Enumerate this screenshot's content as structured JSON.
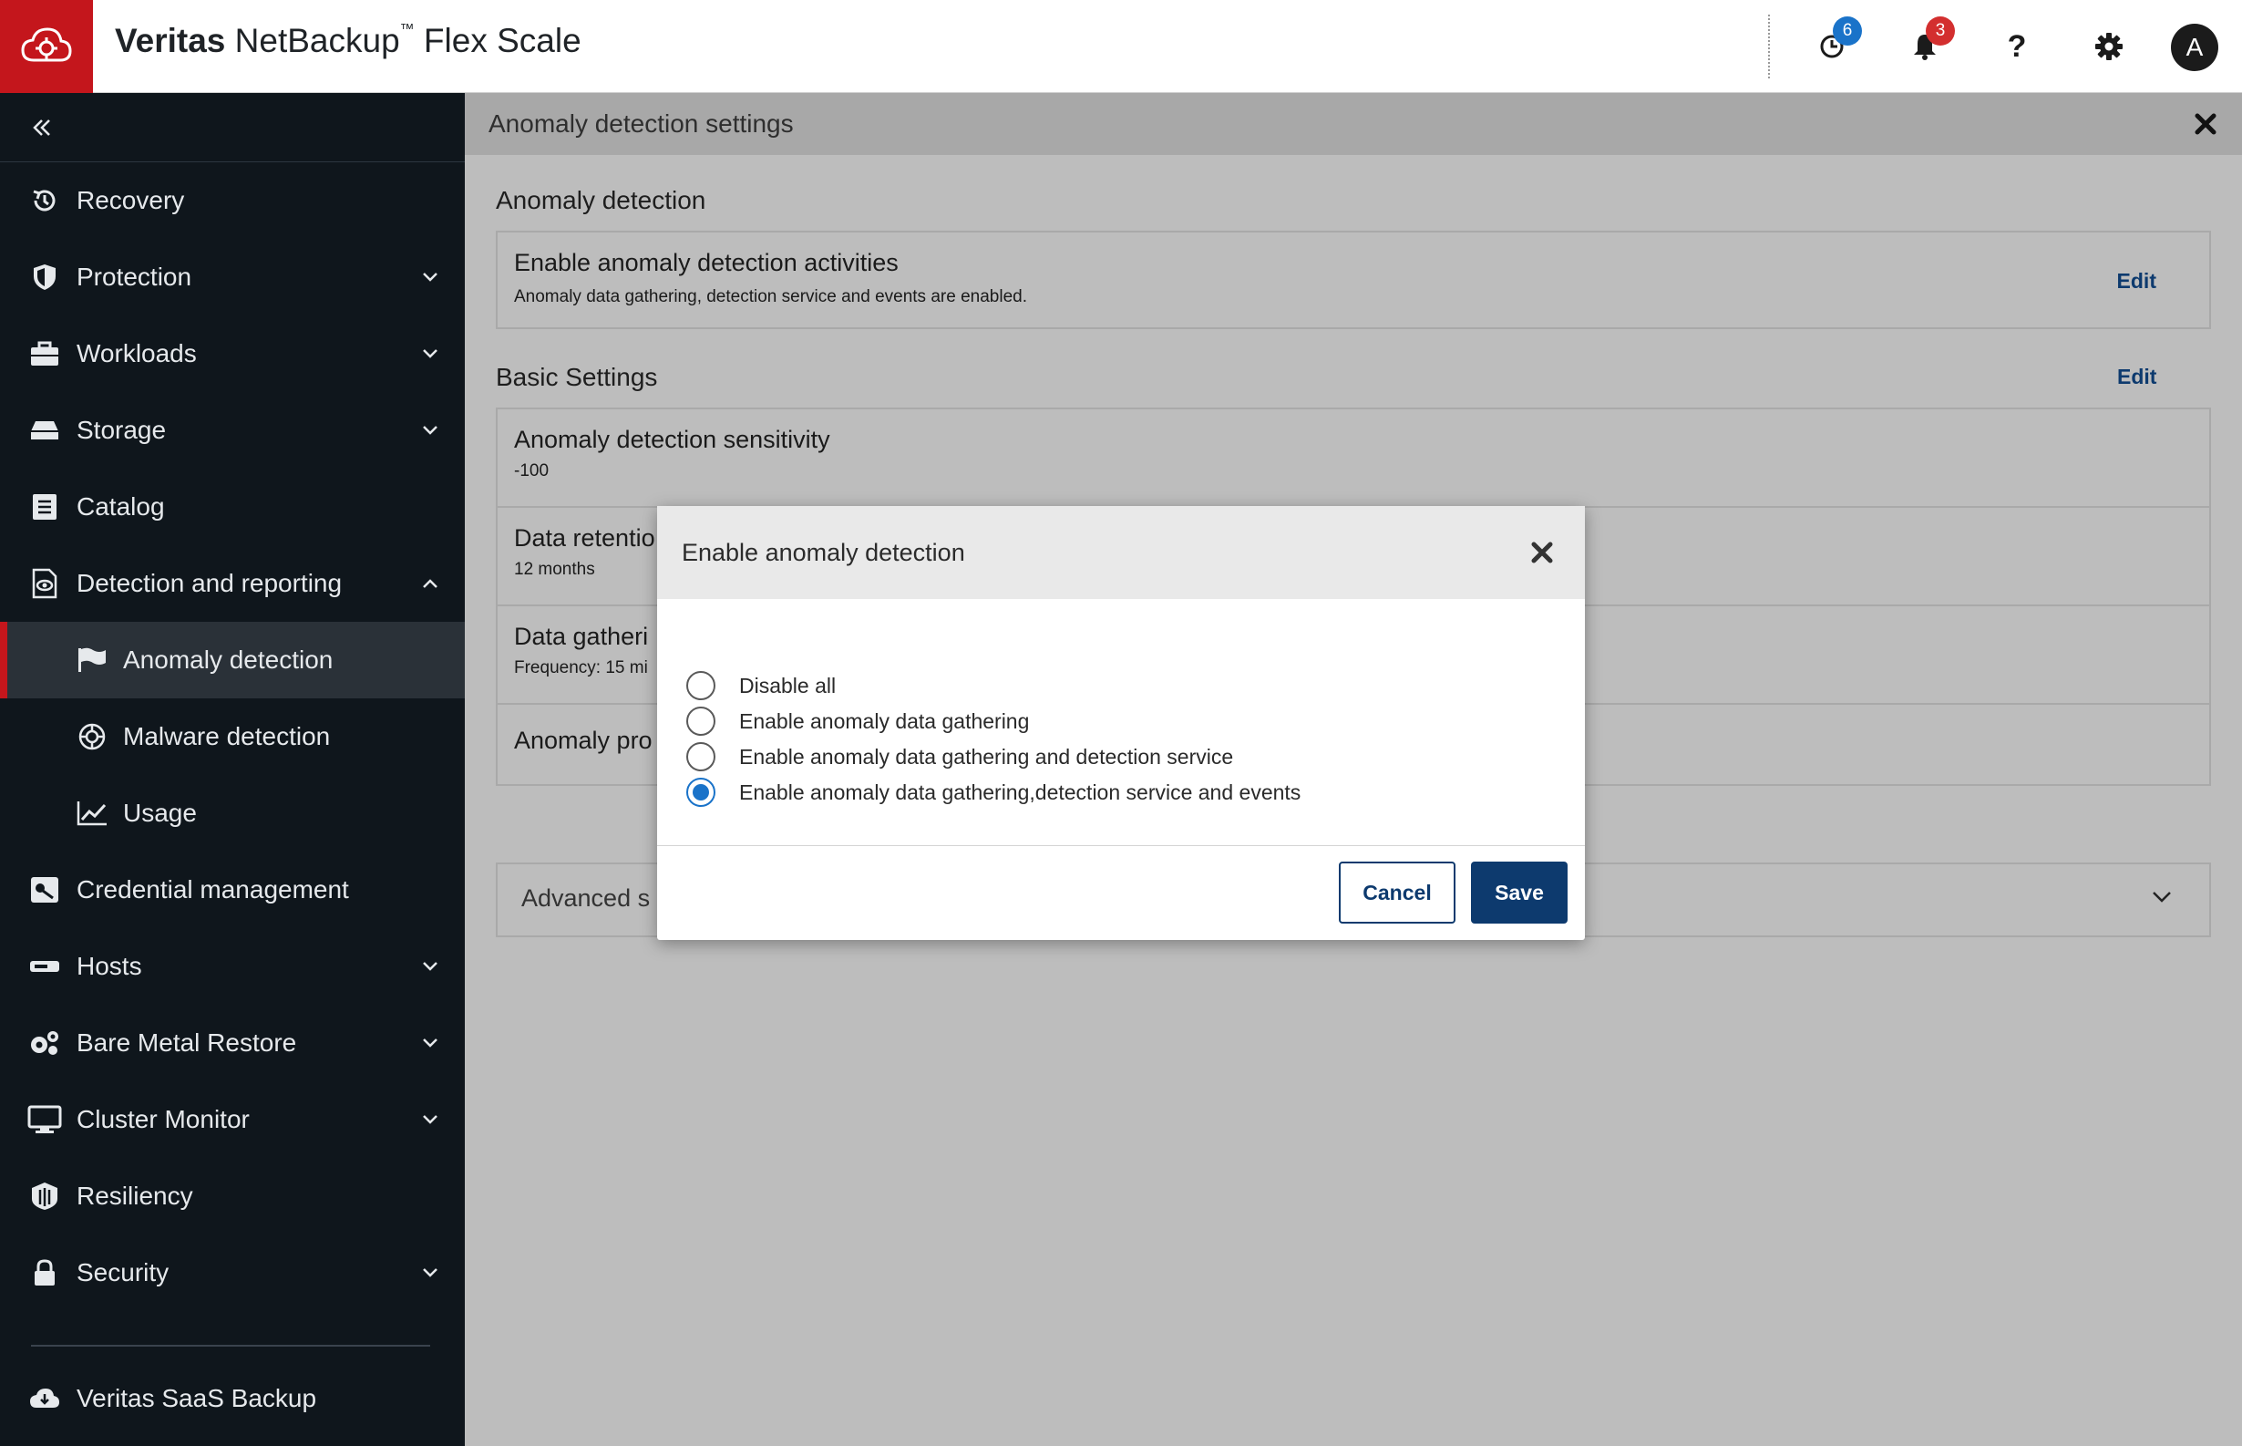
{
  "header": {
    "brand_bold": "Veritas",
    "brand_product": " NetBackup",
    "brand_tm": "™",
    "brand_suffix": " Flex Scale",
    "jobs_badge": "6",
    "notifications_badge": "3",
    "avatar_letter": "A",
    "colors": {
      "brand": "#c4161c",
      "jobs_badge": "#1a73c9",
      "notify_badge": "#d32f2f"
    }
  },
  "sidebar": {
    "items": [
      {
        "label": "Recovery",
        "icon": "recovery-icon"
      },
      {
        "label": "Protection",
        "icon": "shield-icon"
      },
      {
        "label": "Workloads",
        "icon": "briefcase-icon"
      },
      {
        "label": "Storage",
        "icon": "storage-icon"
      },
      {
        "label": "Catalog",
        "icon": "catalog-icon"
      },
      {
        "label": "Detection and reporting",
        "icon": "detection-icon"
      },
      {
        "label": "Anomaly detection",
        "icon": "flag-icon"
      },
      {
        "label": "Malware detection",
        "icon": "virus-icon"
      },
      {
        "label": "Usage",
        "icon": "chart-line-icon"
      },
      {
        "label": "Credential management",
        "icon": "key-icon"
      },
      {
        "label": "Hosts",
        "icon": "host-icon"
      },
      {
        "label": "Bare Metal Restore",
        "icon": "gears-icon"
      },
      {
        "label": "Cluster Monitor",
        "icon": "monitor-icon"
      },
      {
        "label": "Resiliency",
        "icon": "resiliency-icon"
      },
      {
        "label": "Security",
        "icon": "lock-icon"
      },
      {
        "label": "Veritas SaaS Backup",
        "icon": "cloud-icon"
      }
    ],
    "active": "Anomaly detection"
  },
  "panel": {
    "title": "Anomaly detection settings",
    "section1_title": "Anomaly detection",
    "card1_title": "Enable anomaly detection activities",
    "card1_sub": "Anomaly data gathering, detection service and events are enabled.",
    "edit_label": "Edit",
    "section2_title": "Basic Settings",
    "sensitivity_title": "Anomaly detection sensitivity",
    "sensitivity_value": "-100",
    "retention_title": "Data retentio",
    "retention_value": "12 months",
    "gathering_title": "Data gatheri",
    "gathering_value": "Frequency: 15 mi",
    "process_title": "Anomaly pro",
    "advanced_label": "Advanced s"
  },
  "modal": {
    "title": "Enable anomaly detection",
    "options": [
      "Disable all",
      "Enable anomaly data gathering",
      "Enable anomaly data gathering and detection service",
      "Enable anomaly data gathering,detection service and events"
    ],
    "selected_index": 3,
    "cancel_label": "Cancel",
    "save_label": "Save"
  }
}
